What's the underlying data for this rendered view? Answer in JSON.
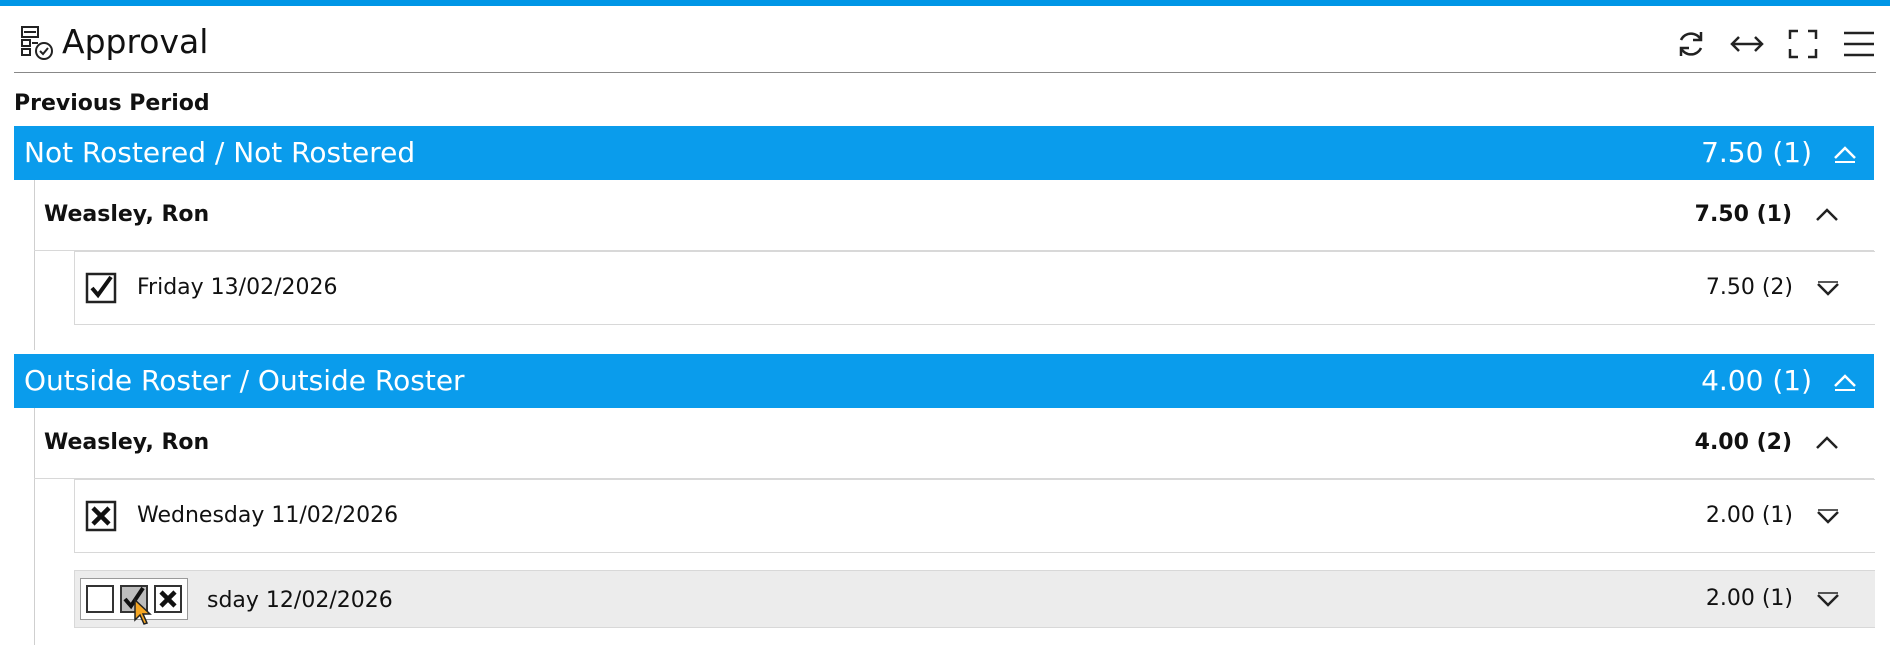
{
  "header": {
    "title": "Approval",
    "icons": [
      "approval-icon",
      "refresh-icon",
      "expand-horizontal-icon",
      "fullscreen-icon",
      "menu-icon"
    ]
  },
  "period_label": "Previous Period",
  "groups": [
    {
      "label": "Not Rostered / Not Rostered",
      "total": "7.50 (1)",
      "person": {
        "name": "Weasley, Ron",
        "total": "7.50 (1)"
      },
      "days": [
        {
          "label": "Friday 13/02/2026",
          "total": "7.50 (2)",
          "status": "approved"
        }
      ]
    },
    {
      "label": "Outside Roster / Outside Roster",
      "total": "4.00 (1)",
      "person": {
        "name": "Weasley, Ron",
        "total": "4.00 (2)"
      },
      "days": [
        {
          "label": "Wednesday 11/02/2026",
          "total": "2.00 (1)",
          "status": "rejected"
        },
        {
          "label": "sday 12/02/2026",
          "total": "2.00 (1)",
          "status": "picker"
        }
      ]
    }
  ],
  "colors": {
    "accent": "#0a9cec",
    "topbar": "#0096e6",
    "hover_row": "#ececec"
  }
}
